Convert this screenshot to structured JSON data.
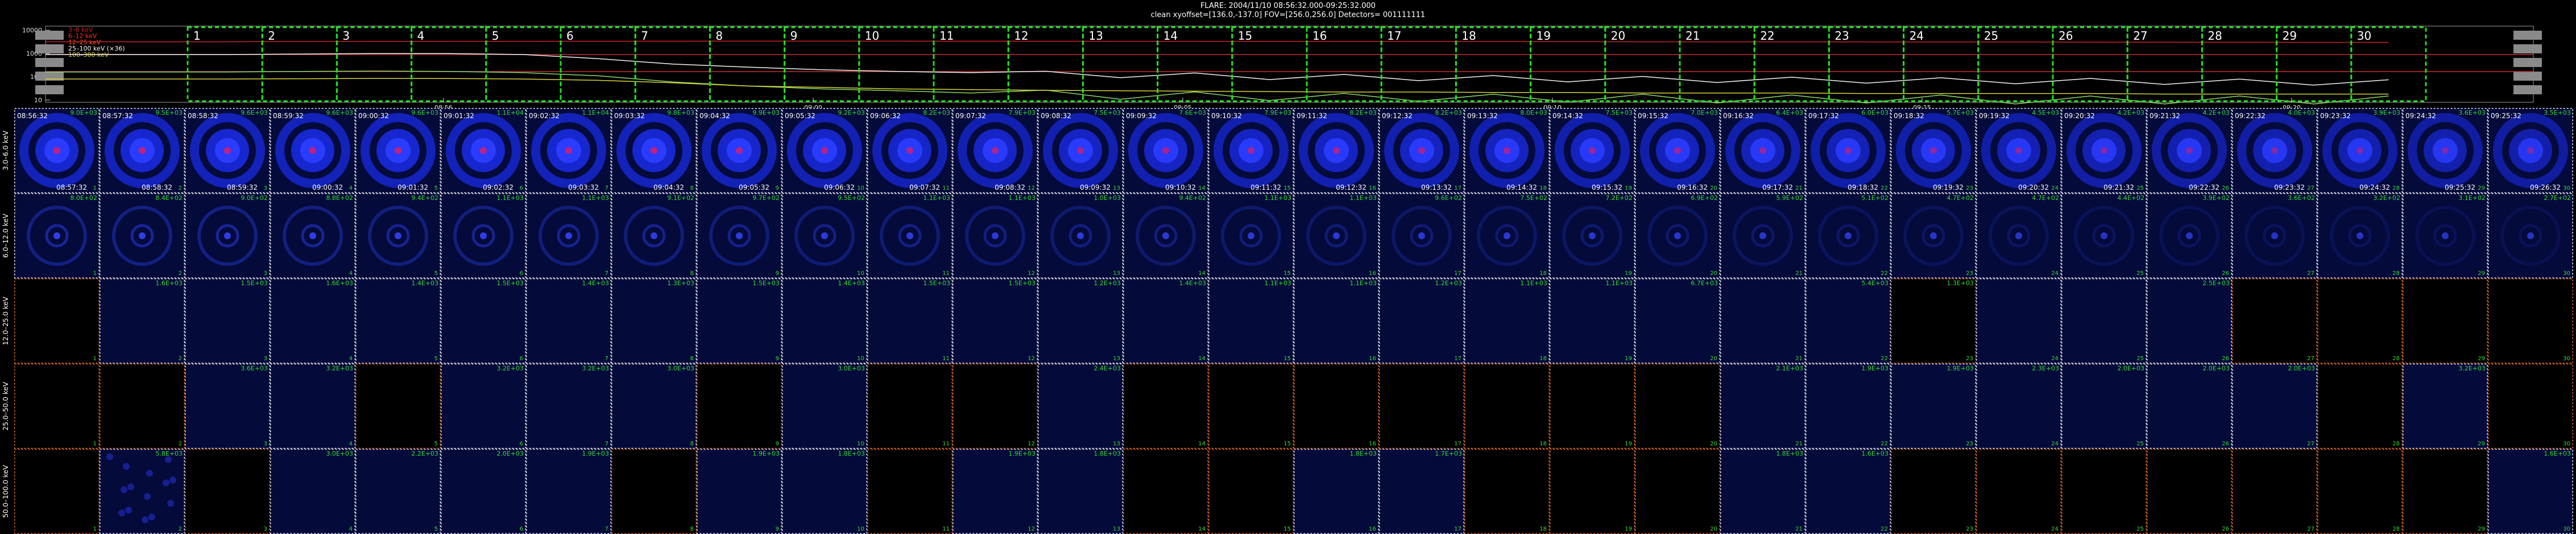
{
  "header": {
    "line1": "FLARE: 2004/11/10 08:56:32.000-09:25:32.000",
    "line2": "clean   xyoffset=[136.0,-137.0]   FOV=[256.0,256.0]   Detectors= 001111111"
  },
  "lightcurve": {
    "y_ticks": [
      "10000",
      "1000",
      "100",
      "10"
    ],
    "legend": [
      {
        "label": "3–6 keV",
        "color": "#cc2222"
      },
      {
        "label": "6–12 keV",
        "color": "#ff3030"
      },
      {
        "label": "12–25 keV",
        "color": "#ff5a1e"
      },
      {
        "label": "25–100 keV (×36)",
        "color": "#ffffff"
      },
      {
        "label": "100–300 keV",
        "color": "#d9d23a"
      }
    ],
    "x_ticks": [
      "08:56",
      "09:00",
      "09:05",
      "09:10",
      "09:15",
      "09:20",
      "09:25"
    ],
    "interval_labels": [
      "1",
      "2",
      "3",
      "4",
      "5",
      "6",
      "7",
      "8",
      "9",
      "10",
      "11",
      "12",
      "13",
      "14",
      "15",
      "16",
      "17",
      "18",
      "19",
      "20",
      "21",
      "22",
      "23",
      "24",
      "25",
      "26",
      "27",
      "28",
      "29",
      "30"
    ]
  },
  "bands": [
    "3.0–6.0 keV",
    "6.0–12.0 keV",
    "12.0–25.0 keV",
    "25.0–50.0 keV",
    "50.0–100.0 keV"
  ],
  "colors": {
    "background": "#000000",
    "grid_solid": "#e6e6e6",
    "grid_empty": "#e06a2a",
    "interval_box": "#22dd22",
    "value_text": "#33dd33",
    "image_bg": "#040a3a",
    "lc_line_white": "#f2f2f2",
    "lc_line_red": "#c23030",
    "lc_line_green": "#8bd86b",
    "lc_line_yellow": "#d9d23a"
  },
  "chart_data": {
    "type": "heatmap",
    "columns": 30,
    "time_start": [
      "08:56:32",
      "08:57:32",
      "08:58:32",
      "08:59:32",
      "09:00:32",
      "09:01:32",
      "09:02:32",
      "09:03:32",
      "09:04:32",
      "09:05:32",
      "09:06:32",
      "09:07:32",
      "09:08:32",
      "09:09:32",
      "09:10:32",
      "09:11:32",
      "09:12:32",
      "09:13:32",
      "09:14:32",
      "09:15:32",
      "09:16:32",
      "09:17:32",
      "09:18:32",
      "09:19:32",
      "09:20:32",
      "09:21:32",
      "09:22:32",
      "09:23:32",
      "09:24:32",
      "09:25:32"
    ],
    "time_end": [
      "08:57:32",
      "08:58:32",
      "08:59:32",
      "09:00:32",
      "09:01:32",
      "09:02:32",
      "09:03:32",
      "09:04:32",
      "09:05:32",
      "09:06:32",
      "09:07:32",
      "09:08:32",
      "09:09:32",
      "09:10:32",
      "09:11:32",
      "09:12:32",
      "09:13:32",
      "09:14:32",
      "09:15:32",
      "09:16:32",
      "09:17:32",
      "09:18:32",
      "09:19:32",
      "09:20:32",
      "09:21:32",
      "09:22:32",
      "09:23:32",
      "09:24:32",
      "09:25:32",
      "09:26:32"
    ],
    "rows": [
      {
        "band": "3.0–6.0 keV",
        "max": [
          "9.0E+03",
          "9.5E+03",
          "9.6E+03",
          "9.6E+03",
          "9.6E+03",
          "1.1E+04",
          "1.1E+04",
          "9.8E+03",
          "9.9E+03",
          "9.2E+03",
          "8.2E+03",
          "7.9E+03",
          "7.5E+03",
          "7.6E+03",
          "7.9E+03",
          "8.2E+03",
          "8.2E+03",
          "8.0E+03",
          "7.5E+03",
          "7.0E+03",
          "6.4E+03",
          "6.0E+03",
          "5.7E+03",
          "4.5E+03",
          "4.2E+03",
          "4.2E+03",
          "4.0E+03",
          "3.9E+03",
          "3.6E+03",
          "3.5E+03"
        ],
        "intensity": [
          1.0,
          1.0,
          1.0,
          1.0,
          1.0,
          1.0,
          1.0,
          1.0,
          0.95,
          0.92,
          0.9,
          0.88,
          0.86,
          0.85,
          0.84,
          0.83,
          0.82,
          0.8,
          0.78,
          0.75,
          0.72,
          0.7,
          0.68,
          0.65,
          0.63,
          0.62,
          0.6,
          0.58,
          0.57,
          0.56
        ]
      },
      {
        "band": "6.0–12.0 keV",
        "max": [
          "8.0E+02",
          "8.4E+02",
          "9.0E+02",
          "8.8E+02",
          "9.4E+02",
          "1.1E+03",
          "1.1E+03",
          "9.1E+02",
          "9.7E+02",
          "9.5E+02",
          "1.1E+03",
          "1.1E+03",
          "1.0E+03",
          "9.4E+02",
          "1.1E+03",
          "1.1E+03",
          "9.6E+02",
          "7.5E+02",
          "7.2E+02",
          "6.9E+02",
          "5.9E+02",
          "5.1E+02",
          "4.7E+02",
          "4.7E+02",
          "4.4E+02",
          "3.9E+02",
          "3.6E+02",
          "3.2E+02",
          "3.1E+02",
          "2.7E+02"
        ],
        "intensity": [
          0.7,
          0.7,
          0.7,
          0.68,
          0.66,
          0.66,
          0.64,
          0.62,
          0.6,
          0.58,
          0.56,
          0.54,
          0.52,
          0.5,
          0.48,
          0.46,
          0.44,
          0.42,
          0.4,
          0.38,
          0.36,
          0.34,
          0.32,
          0.3,
          0.28,
          0.27,
          0.26,
          0.25,
          0.24,
          0.23
        ]
      },
      {
        "band": "12.0–25.0 keV",
        "max": [
          "",
          "1.6E+03",
          "1.5E+03",
          "1.6E+03",
          "1.4E+03",
          "1.5E+03",
          "1.4E+03",
          "1.3E+03",
          "1.5E+03",
          "1.4E+03",
          "1.5E+03",
          "1.5E+03",
          "1.2E+03",
          "1.4E+03",
          "1.1E+03",
          "1.1E+03",
          "1.2E+03",
          "1.1E+03",
          "1.1E+03",
          "6.7E+03",
          "",
          "5.4E+03",
          "1.3E+03",
          "",
          "",
          "2.5E+03",
          "",
          "",
          "",
          ""
        ],
        "intensity": [
          0,
          0.08,
          0.08,
          0.08,
          0.08,
          0.08,
          0.08,
          0.08,
          0.08,
          0.08,
          0.08,
          0.08,
          0.08,
          0.08,
          0.08,
          0.08,
          0.08,
          0.08,
          0.08,
          0.08,
          0.08,
          0.08,
          0,
          0.08,
          0.08,
          0.08,
          0,
          0,
          0,
          0
        ]
      },
      {
        "band": "25.0–50.0 keV",
        "max": [
          "",
          "",
          "3.6E+03",
          "3.2E+03",
          "",
          "3.2E+03",
          "3.2E+03",
          "3.0E+03",
          "",
          "3.0E+03",
          "",
          "",
          "2.4E+03",
          "",
          "",
          "",
          "",
          "",
          "",
          "",
          "2.1E+03",
          "1.9E+03",
          "1.9E+03",
          "2.3E+03",
          "2.0E+03",
          "2.0E+03",
          "2.0E+03",
          "",
          "3.2E+03",
          ""
        ],
        "intensity": [
          0,
          0,
          0.08,
          0.08,
          0,
          0.08,
          0.08,
          0.08,
          0,
          0.08,
          0,
          0,
          0.08,
          0,
          0,
          0,
          0,
          0,
          0,
          0,
          0.08,
          0.08,
          0.08,
          0.08,
          0.08,
          0.08,
          0.08,
          0,
          0.08,
          0
        ]
      },
      {
        "band": "50.0–100.0 keV",
        "max": [
          "",
          "5.8E+03",
          "",
          "3.0E+03",
          "2.2E+03",
          "2.0E+03",
          "1.9E+03",
          "",
          "1.9E+03",
          "1.8E+03",
          "",
          "1.9E+03",
          "1.8E+03",
          "",
          "",
          "1.8E+03",
          "1.7E+03",
          "",
          "",
          "",
          "1.8E+03",
          "1.6E+03",
          "",
          "",
          "",
          "",
          "",
          "",
          "",
          "1.6E+03"
        ],
        "intensity": [
          0,
          0.12,
          0,
          0.08,
          0.08,
          0.08,
          0.08,
          0,
          0.08,
          0.08,
          0,
          0.08,
          0.08,
          0,
          0,
          0.08,
          0.08,
          0,
          0,
          0,
          0.08,
          0.08,
          0,
          0,
          0,
          0,
          0,
          0,
          0,
          0.08
        ]
      }
    ],
    "lightcurve_series": [
      {
        "name": "3–6 keV",
        "color": "#cc2222",
        "values": [
          3200,
          3250,
          3300,
          3320,
          3340,
          3360,
          3380,
          3400,
          3400,
          3400,
          3380,
          3360,
          3340,
          3320,
          3300,
          3280,
          3260,
          3240,
          3220,
          3200,
          3180,
          3160,
          3140,
          3120,
          3100,
          3080,
          3060,
          3040,
          3020,
          3000
        ]
      },
      {
        "name": "6–12 keV",
        "color": "#f2f2f2",
        "values": [
          900,
          950,
          1000,
          1000,
          900,
          600,
          350,
          260,
          200,
          170,
          150,
          130,
          120,
          110,
          100,
          95,
          90,
          85,
          80,
          78,
          75,
          72,
          70,
          68,
          66,
          64,
          62,
          60,
          58,
          56
        ]
      },
      {
        "name": "12–25 keV",
        "color": "#8bd86b",
        "values": [
          160,
          170,
          175,
          170,
          150,
          110,
          60,
          40,
          30,
          25,
          20,
          18,
          16,
          15,
          14,
          13,
          13,
          12,
          12,
          12,
          11,
          11,
          11,
          11,
          10,
          10,
          10,
          10,
          10,
          10
        ]
      },
      {
        "name": "25–100 keV (×36)",
        "color": "#d9d23a",
        "values": [
          80,
          82,
          85,
          84,
          80,
          70,
          55,
          40,
          35,
          30,
          28,
          26,
          25,
          24,
          23,
          22,
          22,
          21,
          21,
          20,
          20,
          20,
          19,
          19,
          19,
          19,
          18,
          18,
          18,
          18
        ]
      }
    ],
    "lightcurve_ylim": [
      8,
      15000
    ],
    "lightcurve_scale": "log"
  }
}
